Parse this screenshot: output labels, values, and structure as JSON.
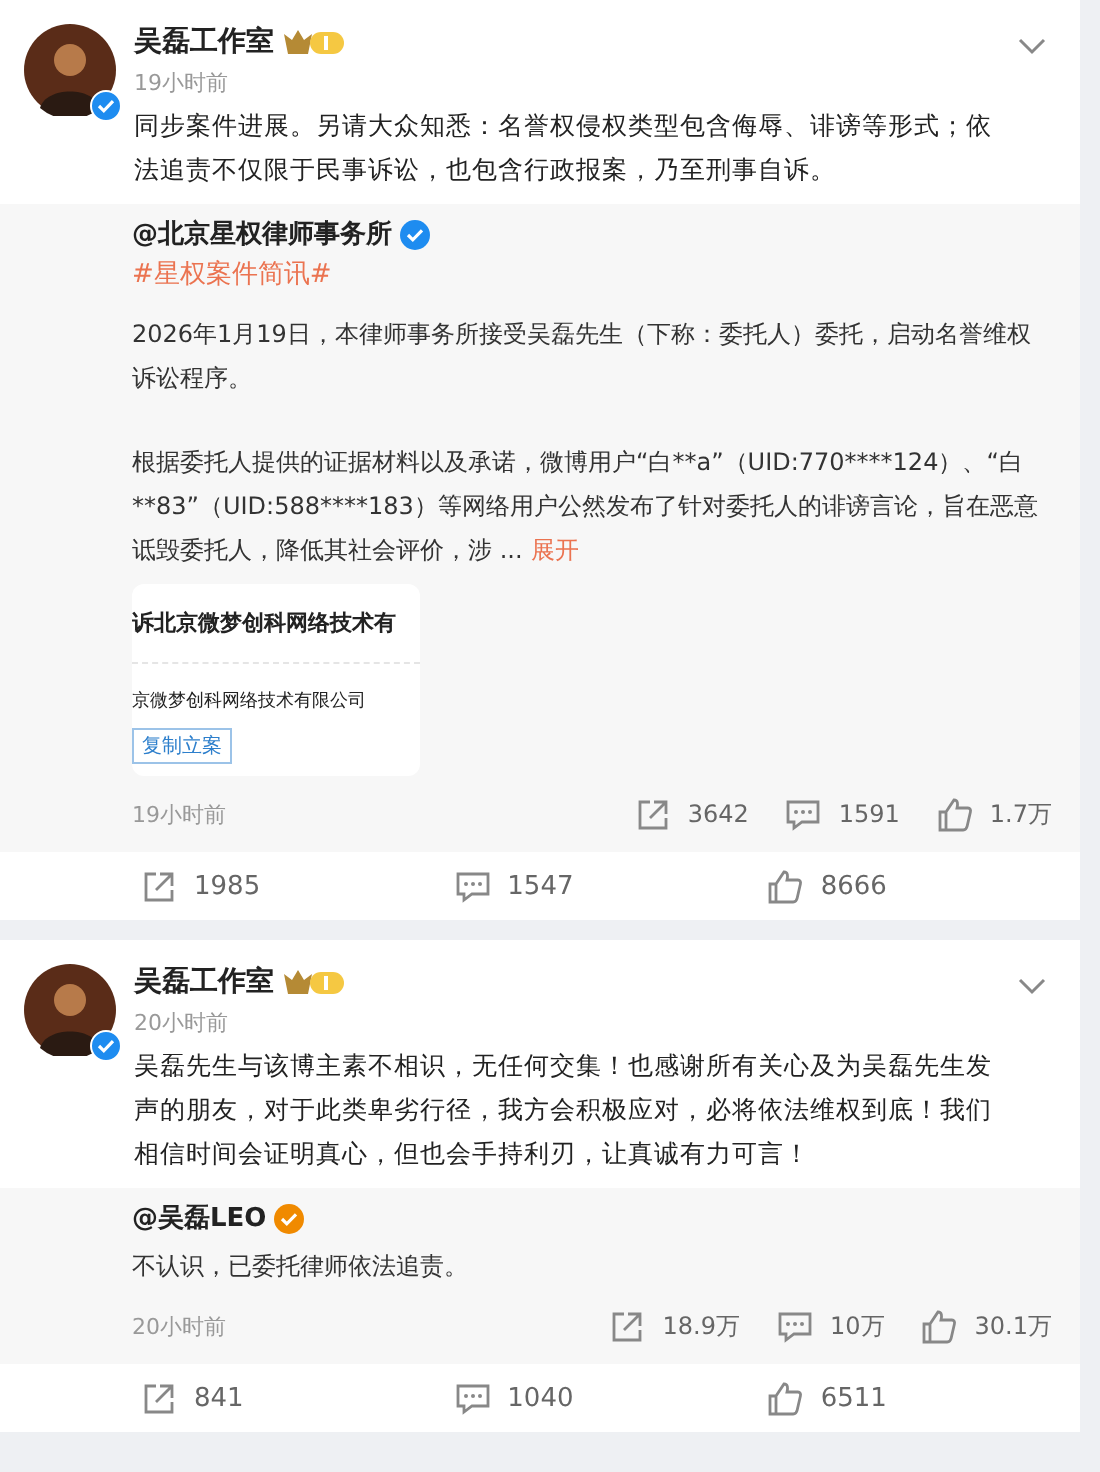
{
  "posts": [
    {
      "author": "吴磊工作室",
      "verified": true,
      "member_badge": true,
      "time": "19小时前",
      "text": "同步案件进展。另请大众知悉：名誉权侵权类型包含侮辱、诽谤等形式；依法追责不仅限于民事诉讼，也包含行政报案，乃至刑事自诉。",
      "repost": {
        "author": "@北京星权律师事务所",
        "color": "#1e8cf0",
        "hashtag": "#星权案件简讯#",
        "paragraphs": [
          "2026年1月19日，本律师事务所接受吴磊先生（下称：委托人）委托，启动名誉维权诉讼程序。",
          "根据委托人提供的证据材料以及承诺，微博用户“白**a”（UID:770****124）、“白**83”（UID:588****183）等网络用户公然发布了针对委托人的诽谤言论，旨在恶意诋毁委托人，降低其社会评价，涉 ..."
        ],
        "expand": "展开",
        "card": {
          "title": "诉北京微梦创科网络技术有",
          "line": "京微梦创科网络技术有限公司",
          "button": "复制立案"
        },
        "time": "19小时前",
        "stats": [
          {
            "kind": "repost",
            "count": "3642"
          },
          {
            "kind": "comment",
            "count": "1591"
          },
          {
            "kind": "like",
            "count": "1.7万"
          }
        ]
      },
      "actions": [
        {
          "kind": "repost",
          "count": "1985"
        },
        {
          "kind": "comment",
          "count": "1547"
        },
        {
          "kind": "like",
          "count": "8666"
        }
      ]
    },
    {
      "author": "吴磊工作室",
      "verified": true,
      "member_badge": true,
      "time": "20小时前",
      "text": "吴磊先生与该博主素不相识，无任何交集！也感谢所有关心及为吴磊先生发声的朋友，对于此类卑劣行径，我方会积极应对，必将依法维权到底！我们相信时间会证明真心，但也会手持利刃，让真诚有力可言！",
      "repost": {
        "author": "@吴磊LEO",
        "color": "#f08a00",
        "paragraphs": [
          "不认识，已委托律师依法追责。"
        ],
        "time": "20小时前",
        "stats": [
          {
            "kind": "repost",
            "count": "18.9万"
          },
          {
            "kind": "comment",
            "count": "10万"
          },
          {
            "kind": "like",
            "count": "30.1万"
          }
        ]
      },
      "actions": [
        {
          "kind": "repost",
          "count": "841"
        },
        {
          "kind": "comment",
          "count": "1040"
        },
        {
          "kind": "like",
          "count": "6511"
        }
      ]
    }
  ]
}
